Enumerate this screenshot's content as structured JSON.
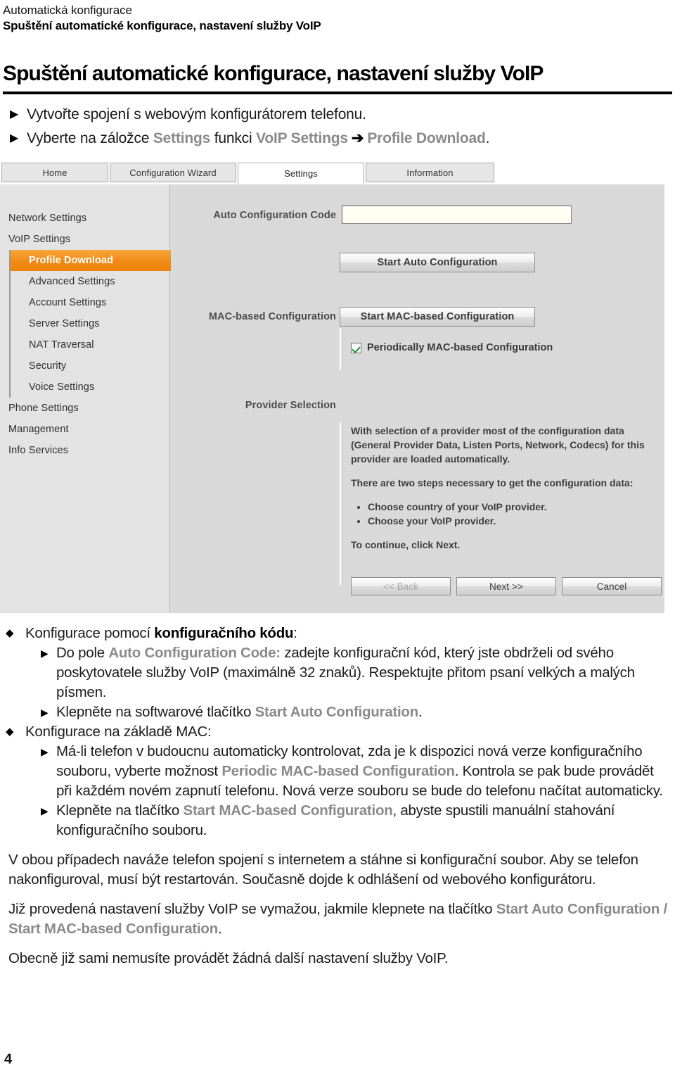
{
  "running_head": {
    "line1": "Automatická konfigurace",
    "line2": "Spuštění automatické konfigurace, nastavení služby VoIP"
  },
  "page_title": "Spuštění automatické konfigurace, nastavení služby VoIP",
  "intro_steps": {
    "bullet_glyph": "▶",
    "arrow_glyph": "➔",
    "step1": "Vytvořte spojení s webovým konfigurátorem telefonu.",
    "step2_pre": "Vyberte na záložce",
    "step2_tab": "Settings",
    "step2_mid": "funkci",
    "step2_menu": "VoIP Settings",
    "step2_submenu": "Profile Download",
    "step2_end": "."
  },
  "screenshot": {
    "tabs": [
      {
        "label": "Home",
        "active": false
      },
      {
        "label": "Configuration Wizard",
        "active": false
      },
      {
        "label": "Settings",
        "active": true
      },
      {
        "label": "Information",
        "active": false
      }
    ],
    "nav": [
      {
        "label": "Network Settings",
        "level": 1,
        "selected": false
      },
      {
        "label": "VoIP Settings",
        "level": 1,
        "selected": false
      },
      {
        "label": "Profile Download",
        "level": 2,
        "selected": true
      },
      {
        "label": "Advanced Settings",
        "level": 2,
        "selected": false
      },
      {
        "label": "Account Settings",
        "level": 2,
        "selected": false
      },
      {
        "label": "Server Settings",
        "level": 2,
        "selected": false
      },
      {
        "label": "NAT Traversal",
        "level": 2,
        "selected": false
      },
      {
        "label": "Security",
        "level": 2,
        "selected": false
      },
      {
        "label": "Voice Settings",
        "level": 2,
        "selected": false
      },
      {
        "label": "Phone Settings",
        "level": 1,
        "selected": false
      },
      {
        "label": "Management",
        "level": 1,
        "selected": false
      },
      {
        "label": "Info Services",
        "level": 1,
        "selected": false
      }
    ],
    "auto_config_label": "Auto Configuration Code",
    "auto_config_value": "",
    "auto_config_placeholder": "",
    "start_auto_button": "Start Auto Configuration",
    "mac_config_label": "MAC-based Configuration",
    "start_mac_button": "Start MAC-based Configuration",
    "periodic_checkbox_label": "Periodically MAC-based Configuration",
    "periodic_checked": true,
    "provider_selection_label": "Provider Selection",
    "info_p1": "With selection of a provider most of the configuration data (General Provider Data, Listen Ports, Network, Codecs) for this provider are loaded automatically.",
    "info_p2": "There are two steps necessary to get the configuration data:",
    "info_bullets": [
      "Choose country of your VoIP provider.",
      "Choose your VoIP provider."
    ],
    "info_p3": "To continue, click Next.",
    "wizard_buttons": {
      "back": "<< Back",
      "next": "Next >>",
      "cancel": "Cancel"
    },
    "accent_orange": "#ee8206",
    "selected_text_color": "#ffffff"
  },
  "body": {
    "diamond_glyph": "◆",
    "triangle_glyph": "▶",
    "b1_pre": "Konfigurace pomocí ",
    "b1_bold": "konfiguračního kódu",
    "b1_post": ":",
    "b1_s1_pre": "Do pole ",
    "b1_s1_term": "Auto Configuration Code:",
    "b1_s1_post": " zadejte konfigurační kód, který jste obdrželi od svého poskytovatele služby VoIP (maximálně 32 znaků). Respektujte přitom psaní velkých a malých písmen.",
    "b1_s2_pre": "Klepněte na softwarové tlačítko ",
    "b1_s2_term": "Start Auto Configuration",
    "b1_s2_post": ".",
    "b2": "Konfigurace na základě MAC:",
    "b2_s1_pre": "Má-li telefon v budoucnu automaticky kontrolovat, zda je k dispozici nová verze konfiguračního souboru, vyberte možnost ",
    "b2_s1_term": "Periodic MAC-based Configuration",
    "b2_s1_post": ". Kontrola se pak bude provádět při každém novém zapnutí telefonu. Nová verze souboru se bude do telefonu načítat automaticky.",
    "b2_s2_pre": "Klepněte na tlačítko ",
    "b2_s2_term": "Start MAC-based Configuration",
    "b2_s2_post": ", abyste spustili manuální stahování konfiguračního souboru.",
    "p1": "V obou případech naváže telefon spojení s internetem a stáhne si konfigurační soubor. Aby se telefon nakonfiguroval, musí být restartován. Současně dojde k odhlášení od webového konfigurátoru.",
    "p2_pre": "Již provedená nastavení služby VoIP se vymažou, jakmile klepnete na tlačítko ",
    "p2_term": "Start Auto Configuration / Start MAC-based Configuration",
    "p2_post": ".",
    "p3": "Obecně již sami nemusíte provádět žádná další nastavení služby VoIP."
  },
  "page_number": "4"
}
